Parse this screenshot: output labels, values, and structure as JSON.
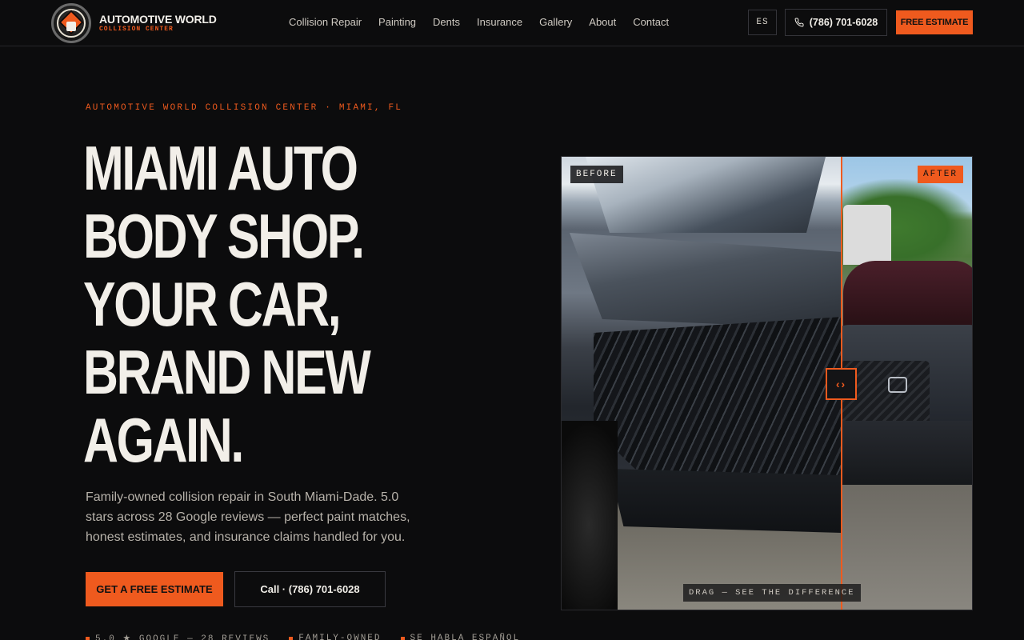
{
  "brand": {
    "name": "Automotive World",
    "subtitle": "Collision Center"
  },
  "nav": {
    "items": [
      "Collision Repair",
      "Painting",
      "Dents",
      "Insurance",
      "Gallery",
      "About",
      "Contact"
    ]
  },
  "header": {
    "lang_label": "ES",
    "phone_label": "(786) 701-6028",
    "estimate_label": "Free Estimate"
  },
  "hero": {
    "eyebrow": "Automotive World Collision Center · Miami, FL",
    "headline_lines": [
      "Miami Auto",
      "Body Shop.",
      "Your Car,",
      "Brand New",
      "Again."
    ],
    "lede": "Family-owned collision repair in South Miami-Dade. 5.0 stars across 28 Google reviews — perfect paint matches, honest estimates, and insurance claims handled for you.",
    "cta_primary": "Get a Free Estimate",
    "cta_secondary": "Call · (786) 701-6028",
    "trust": [
      "5.0 ★ Google — 28 reviews",
      "Family-owned",
      "Se habla Español"
    ]
  },
  "compare": {
    "before_label": "BEFORE",
    "after_label": "AFTER",
    "drag_hint": "DRAG — SEE THE DIFFERENCE",
    "handle_glyph": "‹›",
    "split_fraction": 0.68
  },
  "colors": {
    "accent": "#ef5a1e",
    "background": "#0c0c0d",
    "text": "#f2efe9"
  },
  "icons": {
    "phone": "phone-icon",
    "logo": "logo-badge-icon"
  }
}
